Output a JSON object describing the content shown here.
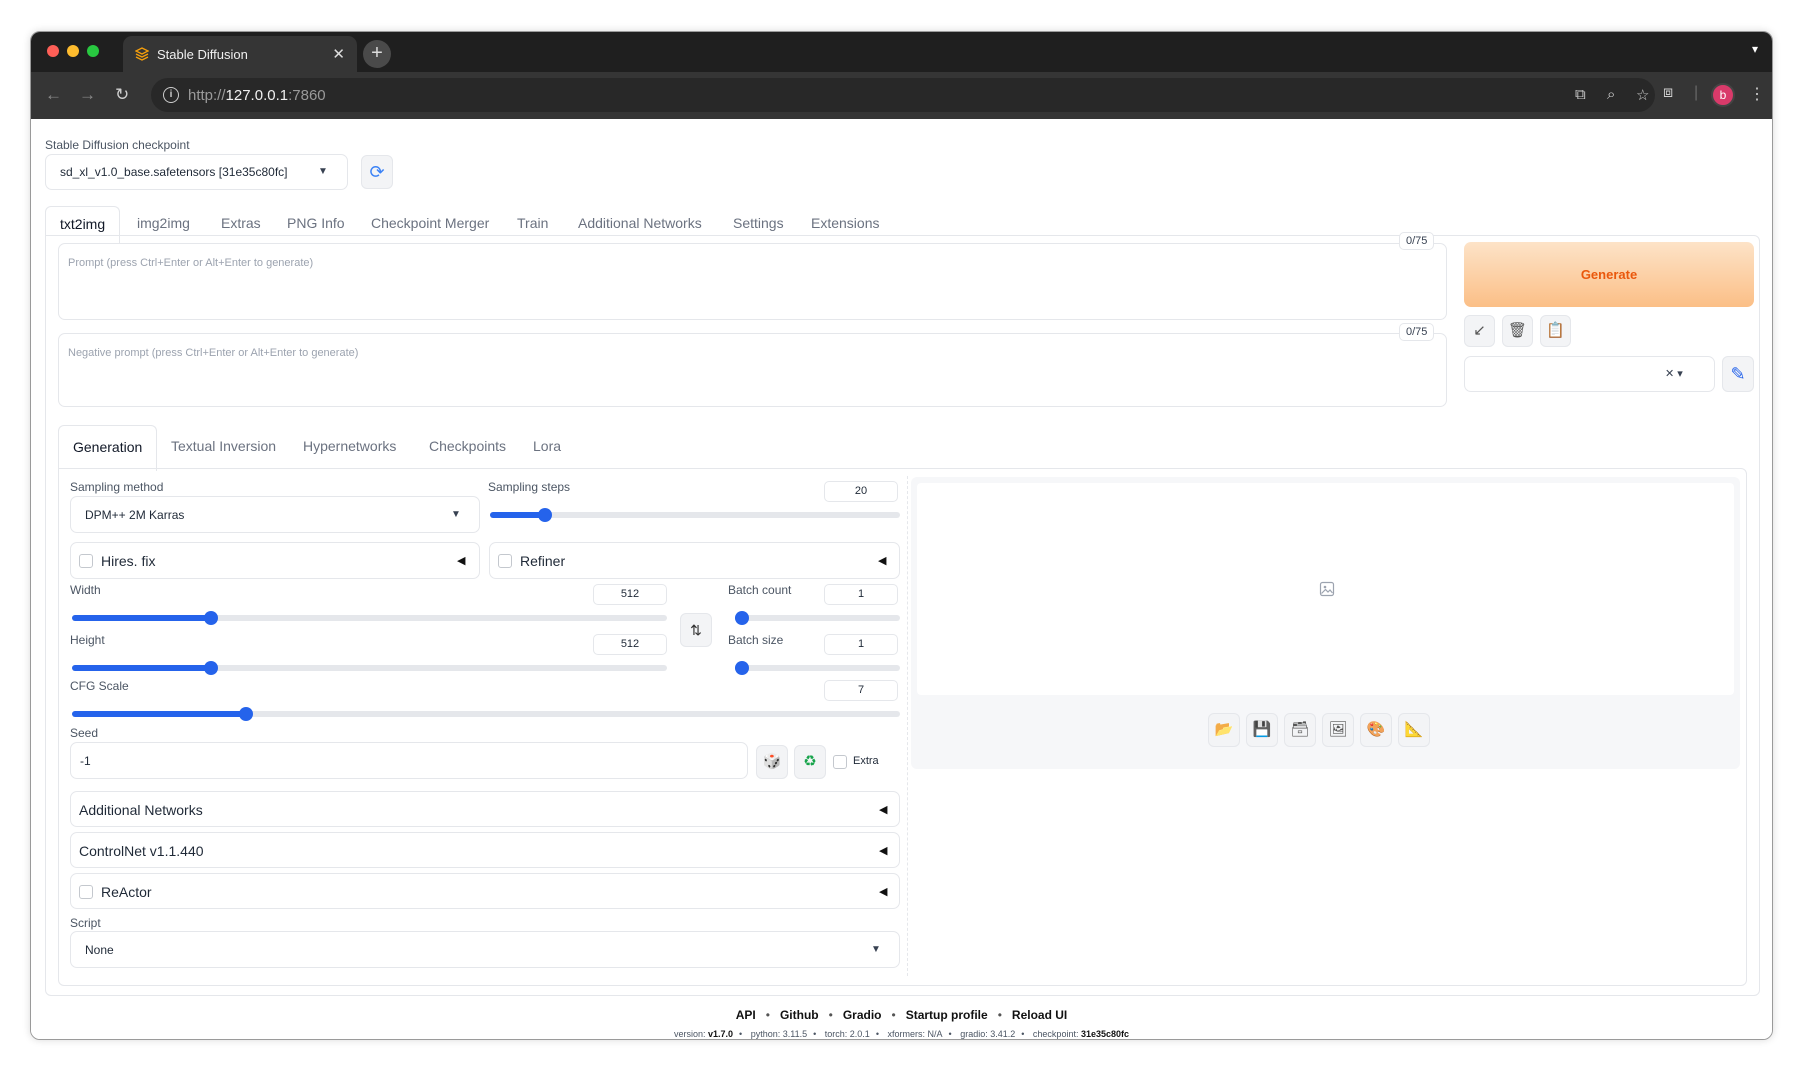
{
  "browser": {
    "tab_title": "Stable Diffusion",
    "url_scheme": "http://",
    "url_host": "127.0.0.1",
    "url_port": ":7860",
    "avatar_letter": "b"
  },
  "checkpoint": {
    "label": "Stable Diffusion checkpoint",
    "value": "sd_xl_v1.0_base.safetensors [31e35c80fc]"
  },
  "main_tabs": [
    "txt2img",
    "img2img",
    "Extras",
    "PNG Info",
    "Checkpoint Merger",
    "Train",
    "Additional Networks",
    "Settings",
    "Extensions"
  ],
  "prompt": {
    "placeholder": "Prompt (press Ctrl+Enter or Alt+Enter to generate)",
    "counter": "0/75"
  },
  "negative_prompt": {
    "placeholder": "Negative prompt (press Ctrl+Enter or Alt+Enter to generate)",
    "counter": "0/75"
  },
  "generate_label": "Generate",
  "sub_tabs": [
    "Generation",
    "Textual Inversion",
    "Hypernetworks",
    "Checkpoints",
    "Lora"
  ],
  "sampling": {
    "method_label": "Sampling method",
    "method_value": "DPM++ 2M Karras",
    "steps_label": "Sampling steps",
    "steps_value": "20",
    "steps_fraction": 0.133
  },
  "hires_label": "Hires. fix",
  "refiner_label": "Refiner",
  "width": {
    "label": "Width",
    "value": "512",
    "fraction": 0.234
  },
  "height": {
    "label": "Height",
    "value": "512",
    "fraction": 0.234
  },
  "batch_count": {
    "label": "Batch count",
    "value": "1",
    "fraction": 0.0
  },
  "batch_size": {
    "label": "Batch size",
    "value": "1",
    "fraction": 0.0
  },
  "cfg": {
    "label": "CFG Scale",
    "value": "7",
    "fraction": 0.21
  },
  "seed": {
    "label": "Seed",
    "value": "-1",
    "extra_label": "Extra"
  },
  "accordions": {
    "additional_networks": "Additional Networks",
    "controlnet": "ControlNet v1.1.440",
    "reactor": "ReActor"
  },
  "script": {
    "label": "Script",
    "value": "None"
  },
  "footer": {
    "links": [
      "API",
      "Github",
      "Gradio",
      "Startup profile",
      "Reload UI"
    ],
    "version_items": [
      {
        "k": "version: ",
        "v": "v1.7.0",
        "bold": true
      },
      {
        "k": "python: ",
        "v": "3.11.5",
        "bold": false
      },
      {
        "k": "torch: ",
        "v": "2.0.1",
        "bold": false
      },
      {
        "k": "xformers: ",
        "v": "N/A",
        "bold": false
      },
      {
        "k": "gradio: ",
        "v": "3.41.2",
        "bold": false
      },
      {
        "k": "checkpoint: ",
        "v": "31e35c80fc",
        "bold": true
      }
    ]
  },
  "colors": {
    "generate_from": "#fde3c8",
    "generate_to": "#fbbf87",
    "generate_text": "#ea580c",
    "slider": "#2563eb"
  }
}
